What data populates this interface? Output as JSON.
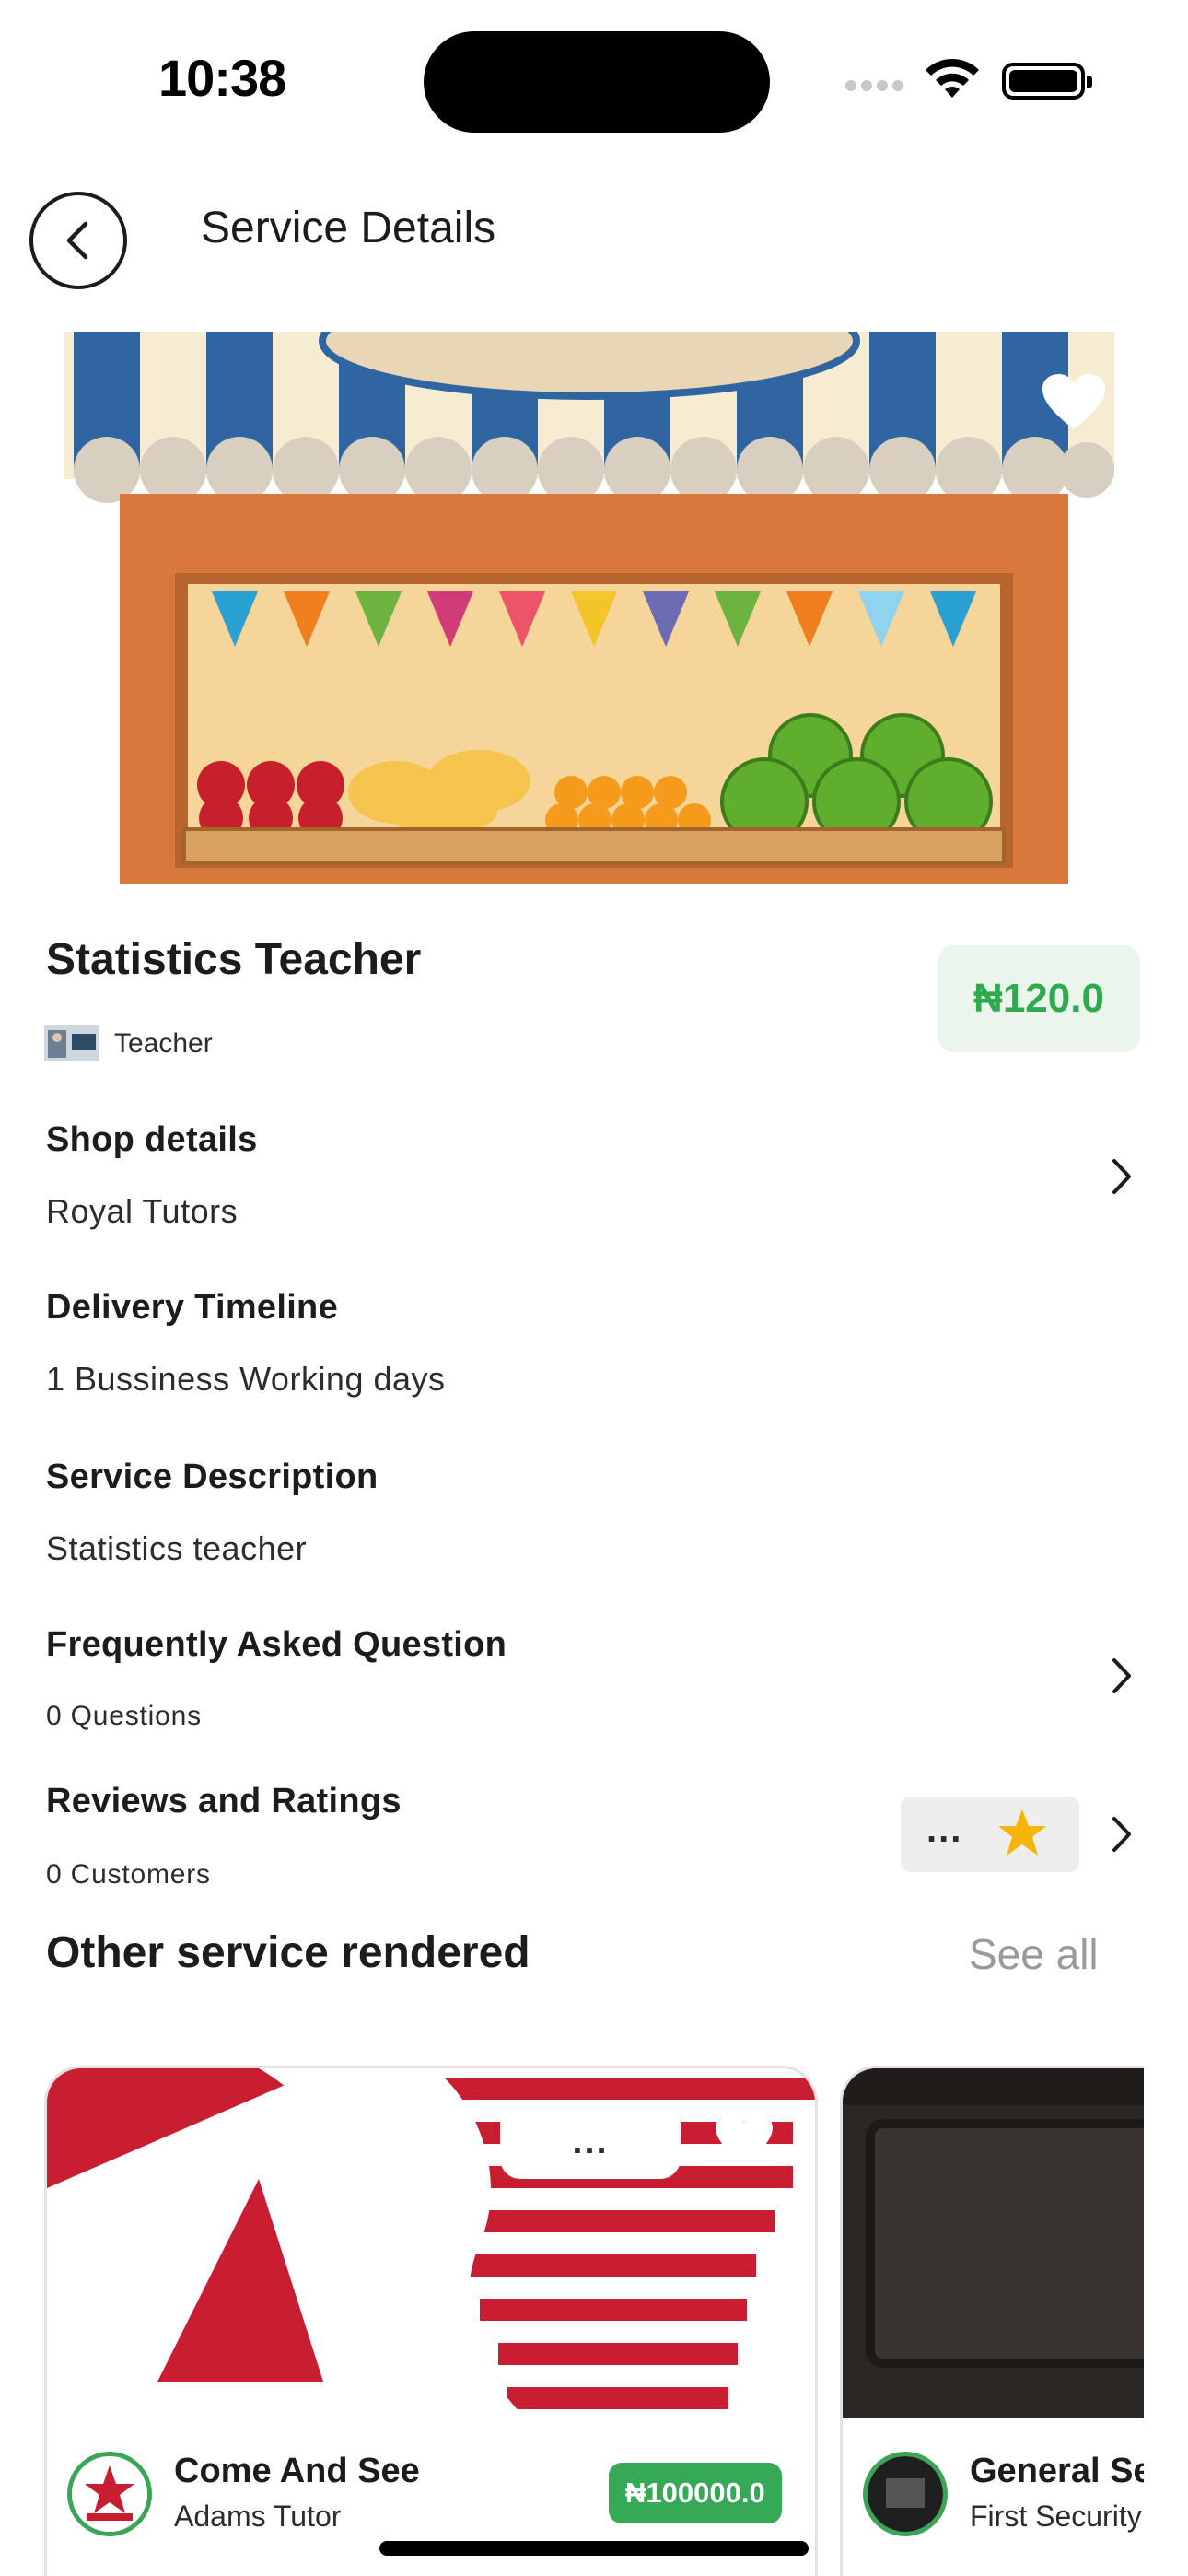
{
  "status_bar": {
    "time": "10:38"
  },
  "header": {
    "title": "Service Details",
    "back_icon": "chevron-left-icon"
  },
  "service": {
    "title": "Statistics Teacher",
    "price": "₦120.0",
    "category": "Teacher",
    "favorite_icon": "heart-icon"
  },
  "sections": {
    "shop": {
      "heading": "Shop details",
      "value": "Royal Tutors"
    },
    "delivery": {
      "heading": "Delivery Timeline",
      "value": "1 Bussiness Working days"
    },
    "description": {
      "heading": "Service Description",
      "value": "Statistics teacher"
    },
    "faq": {
      "heading": "Frequently Asked Question",
      "value": "0 Questions"
    },
    "reviews": {
      "heading": "Reviews and Ratings",
      "value": "0 Customers",
      "rating": "..."
    }
  },
  "other": {
    "title": "Other service rendered",
    "see_all": "See all",
    "cards": [
      {
        "name": "Come And See",
        "shop": "Adams Tutor",
        "price": "₦100000.0",
        "rating": "..."
      },
      {
        "name": "General Se",
        "shop": "First Security"
      }
    ]
  },
  "colors": {
    "price_green": "#2faa4f",
    "price_chip_bg": "#eaf6ec",
    "star": "#f5b50a",
    "muted": "#9a9a9e"
  }
}
